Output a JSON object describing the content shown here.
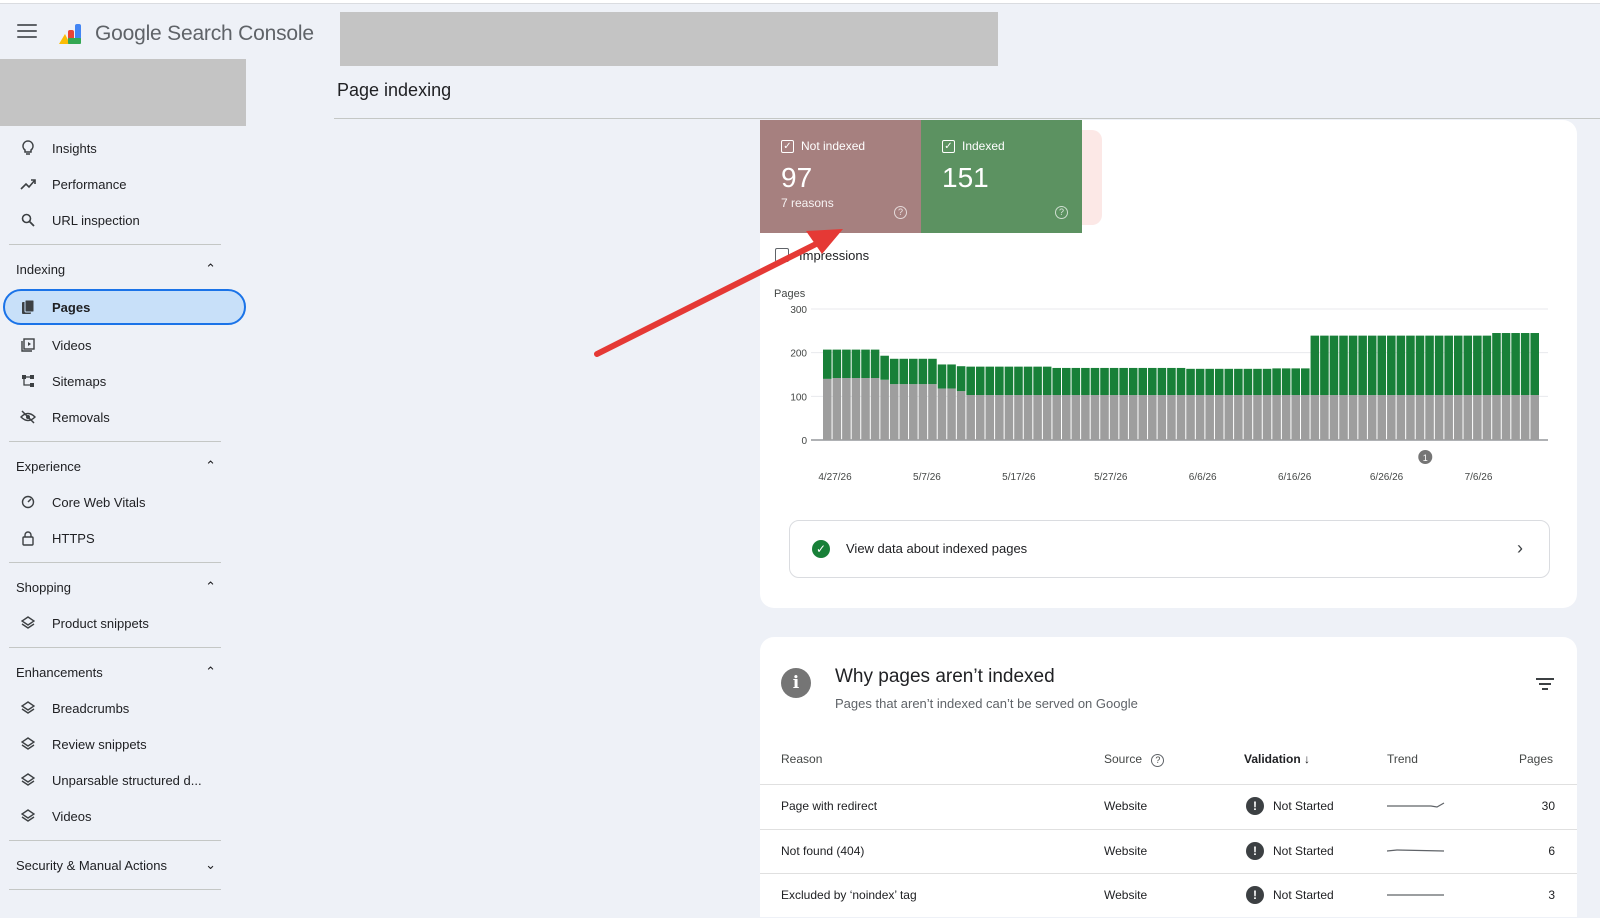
{
  "app": {
    "name": "Google Search Console",
    "brand_first": "Google",
    "brand_second": "Search Console"
  },
  "page": {
    "title": "Page indexing"
  },
  "sidebar": {
    "top_items": [
      {
        "label": "Insights",
        "icon": "lightbulb-icon"
      },
      {
        "label": "Performance",
        "icon": "trending-up-icon"
      },
      {
        "label": "URL inspection",
        "icon": "search-icon"
      }
    ],
    "sections": {
      "indexing": {
        "title": "Indexing",
        "items": [
          {
            "label": "Pages",
            "icon": "pages-icon",
            "active": true
          },
          {
            "label": "Videos",
            "icon": "video-library-icon"
          },
          {
            "label": "Sitemaps",
            "icon": "sitemap-icon"
          },
          {
            "label": "Removals",
            "icon": "eye-off-icon"
          }
        ]
      },
      "experience": {
        "title": "Experience",
        "items": [
          {
            "label": "Core Web Vitals",
            "icon": "speed-gauge-icon"
          },
          {
            "label": "HTTPS",
            "icon": "lock-icon"
          }
        ]
      },
      "shopping": {
        "title": "Shopping",
        "items": [
          {
            "label": "Product snippets",
            "icon": "layers-icon"
          }
        ]
      },
      "enhancements": {
        "title": "Enhancements",
        "items": [
          {
            "label": "Breadcrumbs",
            "icon": "layers-icon"
          },
          {
            "label": "Review snippets",
            "icon": "layers-icon"
          },
          {
            "label": "Unparsable structured d...",
            "icon": "layers-icon"
          },
          {
            "label": "Videos",
            "icon": "layers-icon"
          }
        ]
      },
      "security": {
        "title": "Security & Manual Actions"
      }
    }
  },
  "summary": {
    "not_indexed": {
      "label": "Not indexed",
      "count": "97",
      "sub": "7 reasons",
      "color": "#a6807f"
    },
    "indexed": {
      "label": "Indexed",
      "count": "151",
      "color": "#5c9261"
    },
    "impressions_label": "Impressions"
  },
  "chart_data": {
    "type": "bar",
    "stacked": true,
    "ylabel": "Pages",
    "ylim": [
      0,
      300
    ],
    "yticks": [
      "300",
      "200",
      "100",
      "0"
    ],
    "xtick_labels": [
      "4/27/26",
      "5/7/26",
      "5/17/26",
      "5/27/26",
      "6/6/26",
      "6/16/26",
      "6/26/26",
      "7/6/26"
    ],
    "annotation_marker": "1",
    "series": [
      {
        "color": "#9e9e9e",
        "values": [
          140,
          142,
          142,
          142,
          142,
          142,
          138,
          128,
          128,
          128,
          128,
          128,
          118,
          118,
          112,
          103,
          103,
          103,
          103,
          103,
          103,
          103,
          103,
          103,
          103,
          103,
          103,
          103,
          103,
          103,
          103,
          103,
          103,
          103,
          103,
          103,
          103,
          103,
          103,
          103,
          103,
          103,
          103,
          103,
          103,
          103,
          103,
          103,
          103,
          103,
          103,
          103,
          103,
          103,
          103,
          103,
          103,
          103,
          103,
          103,
          103,
          103,
          103,
          103,
          103,
          103,
          103,
          103,
          103,
          103,
          103,
          103,
          103,
          103,
          103
        ]
      },
      {
        "color": "#188038",
        "values": [
          67,
          65,
          65,
          65,
          65,
          65,
          55,
          58,
          58,
          58,
          58,
          58,
          55,
          55,
          57,
          65,
          65,
          65,
          65,
          65,
          65,
          65,
          65,
          65,
          62,
          62,
          62,
          62,
          62,
          62,
          62,
          62,
          62,
          62,
          62,
          62,
          62,
          62,
          60,
          60,
          60,
          60,
          60,
          60,
          60,
          60,
          60,
          61,
          61,
          61,
          61,
          136,
          136,
          136,
          136,
          136,
          136,
          136,
          136,
          136,
          136,
          136,
          136,
          136,
          136,
          136,
          136,
          136,
          136,
          136,
          142,
          142,
          142,
          142,
          142
        ]
      }
    ]
  },
  "view_indexed": {
    "label": "View data about indexed pages"
  },
  "why": {
    "title": "Why pages aren’t indexed",
    "subtitle": "Pages that aren’t indexed can’t be served on Google",
    "columns": {
      "reason": "Reason",
      "source": "Source",
      "validation": "Validation",
      "trend": "Trend",
      "pages": "Pages"
    },
    "rows": [
      {
        "reason": "Page with redirect",
        "source": "Website",
        "validation": "Not Started",
        "pages": "30"
      },
      {
        "reason": "Not found (404)",
        "source": "Website",
        "validation": "Not Started",
        "pages": "6"
      },
      {
        "reason": "Excluded by ‘noindex’ tag",
        "source": "Website",
        "validation": "Not Started",
        "pages": "3"
      }
    ]
  },
  "colors": {
    "accent": "#1a73e8",
    "arrow": "#e53935",
    "indexed": "#188038",
    "not_indexed_bar": "#9e9e9e"
  }
}
